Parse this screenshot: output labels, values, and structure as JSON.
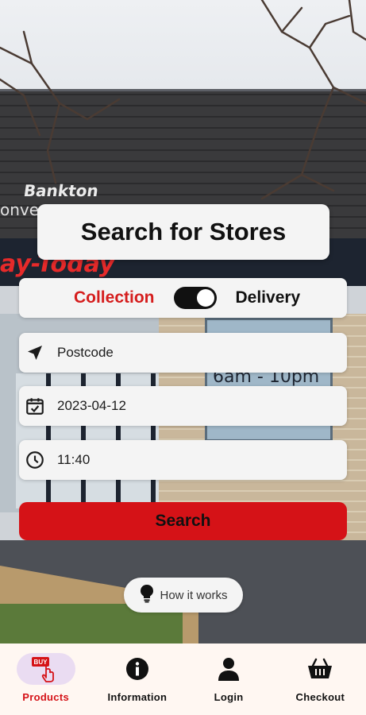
{
  "background": {
    "sign_line_1": "Bankton",
    "sign_line_2": "onven",
    "sign_brand": "ay-Today",
    "poster_text": "6am - 10pm"
  },
  "header": {
    "title": "Search for Stores"
  },
  "mode_toggle": {
    "left_label": "Collection",
    "right_label": "Delivery",
    "active": "Collection"
  },
  "fields": {
    "postcode": {
      "value": "Postcode",
      "icon": "navigation-arrow-icon"
    },
    "date": {
      "value": "2023-04-12",
      "icon": "calendar-check-icon"
    },
    "time": {
      "value": "11:40",
      "icon": "clock-icon"
    }
  },
  "search_button": {
    "label": "Search"
  },
  "how_it_works": {
    "label": "How it works",
    "icon": "lightbulb-icon"
  },
  "bottom_nav": {
    "items": [
      {
        "label": "Products",
        "icon": "buy-tap-icon",
        "active": true
      },
      {
        "label": "Information",
        "icon": "info-icon",
        "active": false
      },
      {
        "label": "Login",
        "icon": "user-icon",
        "active": false
      },
      {
        "label": "Checkout",
        "icon": "basket-icon",
        "active": false
      }
    ]
  },
  "colors": {
    "accent_red": "#d51217",
    "card_bg": "#f4f4f4",
    "nav_bg": "#fff7f2",
    "active_pill": "#eadcf2"
  }
}
